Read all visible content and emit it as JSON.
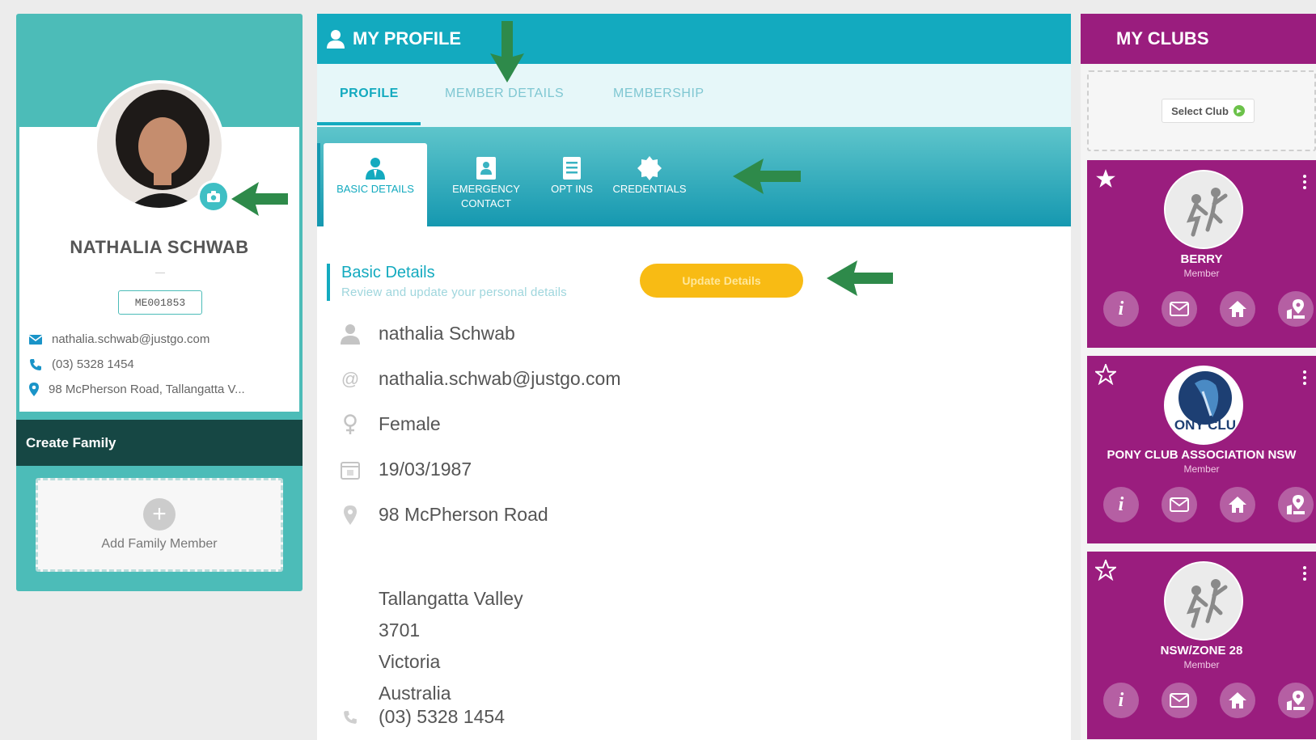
{
  "profile_card": {
    "name": "NATHALIA SCHWAB",
    "member_id": "ME001853",
    "email": "nathalia.schwab@justgo.com",
    "phone": "(03) 5328 1454",
    "address": "98 McPherson Road, Tallangatta V...",
    "create_family_label": "Create Family",
    "add_family_label": "Add Family Member",
    "add_family_icon": "+"
  },
  "my_profile": {
    "title": "MY PROFILE",
    "tabs": [
      {
        "label": "PROFILE",
        "active": true
      },
      {
        "label": "MEMBER DETAILS",
        "active": false
      },
      {
        "label": "MEMBERSHIP",
        "active": false
      }
    ],
    "subtabs": [
      {
        "label": "BASIC DETAILS",
        "icon": "person-icon",
        "active": true
      },
      {
        "label": "EMERGENCY\nCONTACT",
        "icon": "contact-card-icon",
        "active": false
      },
      {
        "label": "OPT INS",
        "icon": "list-icon",
        "active": false
      },
      {
        "label": "CREDENTIALS",
        "icon": "badge-icon",
        "active": false
      }
    ],
    "section_title": "Basic Details",
    "section_subtitle": "Review and update your personal details",
    "update_button": "Update Details",
    "details": {
      "name": "nathalia Schwab",
      "email": "nathalia.schwab@justgo.com",
      "gender": "Female",
      "dob": "19/03/1987",
      "address_line1": "98 McPherson Road",
      "suburb": "Tallangatta Valley",
      "postcode": "3701",
      "state": "Victoria",
      "country": "Australia",
      "phone": "(03) 5328 1454"
    }
  },
  "my_clubs": {
    "title": "MY CLUBS",
    "select_club_label": "Select Club",
    "clubs": [
      {
        "name": "BERRY",
        "role": "Member",
        "favorite": true,
        "logo_text": ""
      },
      {
        "name": "PONY CLUB ASSOCIATION NSW",
        "role": "Member",
        "favorite": false,
        "logo_text": "ONY CLU"
      },
      {
        "name": "NSW/ZONE 28",
        "role": "Member",
        "favorite": false,
        "logo_text": ""
      }
    ]
  },
  "colors": {
    "teal": "#13aabf",
    "left_teal": "#4cbcb8",
    "dark_teal": "#164744",
    "magenta": "#9a1d7e",
    "yellow": "#f8bb14",
    "arrow_green": "#2e8a4a"
  }
}
